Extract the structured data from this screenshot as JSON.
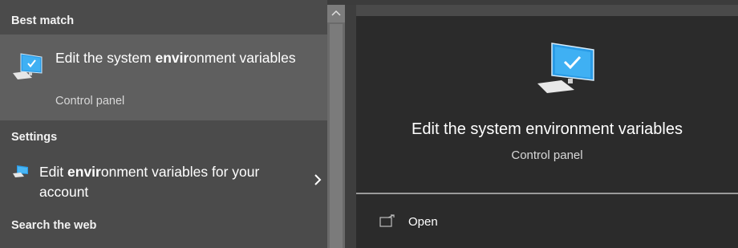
{
  "sections": {
    "best_match": "Best match",
    "settings": "Settings",
    "search_web": "Search the web"
  },
  "best_match": {
    "title_before": "Edit the system ",
    "title_bold": "envir",
    "title_after": "onment variables",
    "subtitle": "Control panel",
    "icon": "monitor-check-icon"
  },
  "settings_item": {
    "title_before": "Edit ",
    "title_bold": "envir",
    "title_after": "onment variables for your account",
    "icon": "computer-settings-icon"
  },
  "preview": {
    "title": "Edit the system environment variables",
    "subtitle": "Control panel",
    "icon": "monitor-check-icon",
    "open_label": "Open",
    "open_icon": "open-window-icon"
  }
}
